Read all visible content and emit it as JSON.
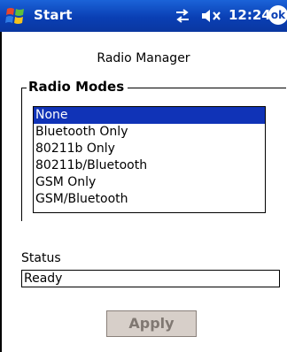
{
  "titlebar": {
    "app_title": "Start",
    "clock": "12:24",
    "ok_label": "ok",
    "icons": [
      "windows-start-flag-icon",
      "connectivity-arrows-icon",
      "speaker-volume-icon",
      "ok-button"
    ]
  },
  "page": {
    "title": "Radio Manager"
  },
  "radio_modes": {
    "group_label": "Radio Modes",
    "options": [
      "None",
      "Bluetooth Only",
      "80211b Only",
      "80211b/Bluetooth",
      "GSM Only",
      "GSM/Bluetooth"
    ],
    "selected": "None"
  },
  "status": {
    "label": "Status",
    "value": "Ready"
  },
  "actions": {
    "apply_label": "Apply",
    "apply_enabled": false
  },
  "colors": {
    "titlebar": "#0a3fb4",
    "selection": "#1033b7",
    "button_disabled_bg": "#d7cfc9",
    "button_disabled_text": "#807872"
  }
}
